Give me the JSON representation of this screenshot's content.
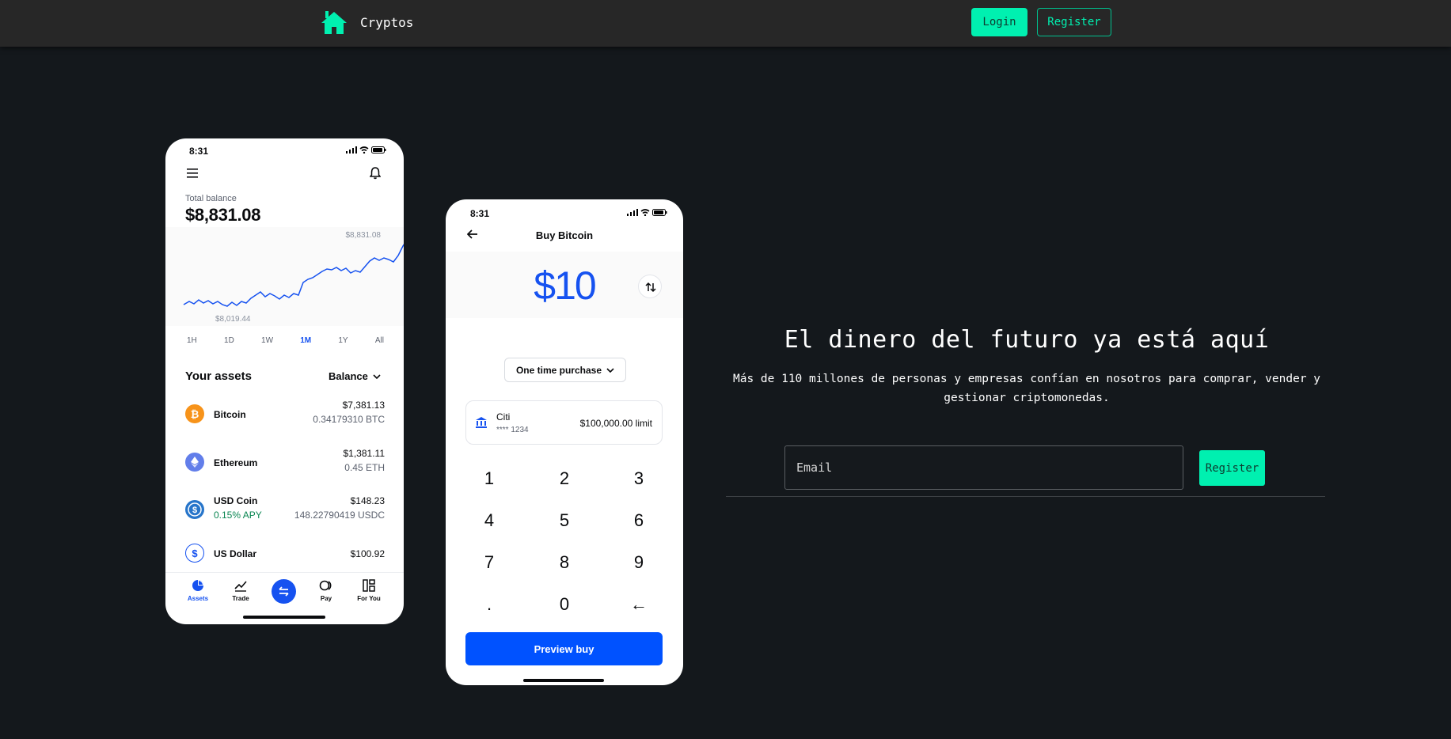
{
  "navbar": {
    "brand_name": "Cryptos",
    "login_label": "Login",
    "register_label": "Register"
  },
  "phone_assets": {
    "time": "8:31",
    "total_label": "Total balance",
    "total_value": "$8,831.08",
    "chart_high": "$8,831.08",
    "chart_low": "$8,019.44",
    "ranges": [
      "1H",
      "1D",
      "1W",
      "1M",
      "1Y",
      "All"
    ],
    "active_range": "1M",
    "assets_title": "Your assets",
    "balance_selector": "Balance",
    "assets": [
      {
        "name": "Bitcoin",
        "value": "$7,381.13",
        "amount": "0.34179310 BTC",
        "sub": "",
        "icon": "bitcoin-icon",
        "color": "#f7931a"
      },
      {
        "name": "Ethereum",
        "value": "$1,381.11",
        "amount": "0.45 ETH",
        "sub": "",
        "icon": "ethereum-icon",
        "color": "#627eea"
      },
      {
        "name": "USD Coin",
        "value": "$148.23",
        "amount": "148.22790419 USDC",
        "sub": "0.15% APY",
        "icon": "usdc-icon",
        "color": "#2775ca"
      },
      {
        "name": "US Dollar",
        "value": "$100.92",
        "amount": "",
        "sub": "",
        "icon": "dollar-icon",
        "color": "#1652f0"
      }
    ],
    "tabs": [
      "Assets",
      "Trade",
      "",
      "Pay",
      "For You"
    ]
  },
  "phone_buy": {
    "time": "8:31",
    "title": "Buy Bitcoin",
    "amount": "$10",
    "purchase_type": "One time purchase",
    "bank_name": "Citi",
    "bank_account": "**** 1234",
    "bank_limit": "$100,000.00 limit",
    "keys": [
      "1",
      "2",
      "3",
      "4",
      "5",
      "6",
      "7",
      "8",
      "9",
      ".",
      "0",
      "←"
    ],
    "preview_label": "Preview buy"
  },
  "hero": {
    "title": "El dinero del futuro ya está aquí",
    "subtitle": "Más de 110 millones de personas y empresas confían en nosotros para comprar, vender y gestionar criptomonedas.",
    "email_placeholder": "Email",
    "register_label": "Register"
  },
  "colors": {
    "accent": "#00f0b0",
    "background": "#14181c",
    "navbar": "#272727",
    "brand_blue": "#1652f0"
  }
}
